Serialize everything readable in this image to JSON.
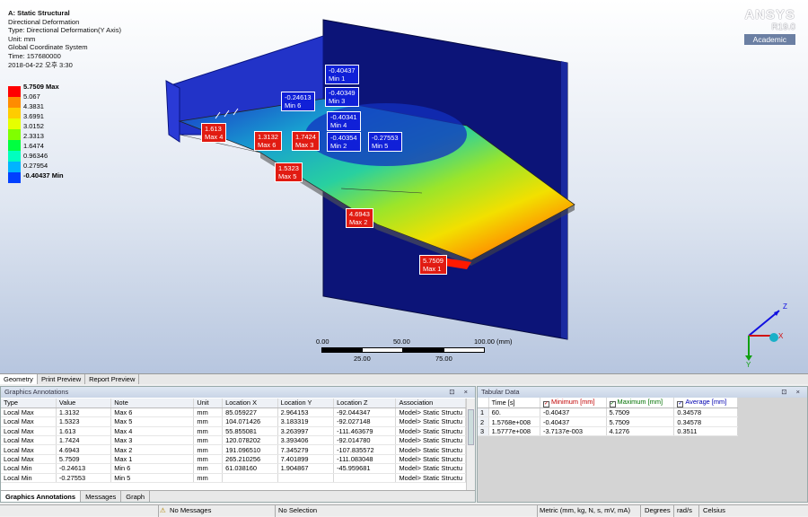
{
  "viewport": {
    "info": {
      "title": "A: Static Structural",
      "lines": [
        "Directional Deformation",
        "Type: Directional Deformation(Y Axis)",
        "Unit: mm",
        "Global Coordinate System",
        "Time: 157680000",
        "2018-04-22 오후 3:30"
      ]
    },
    "legend": {
      "levels": [
        "5.7509 Max",
        "5.067",
        "4.3831",
        "3.6991",
        "3.0152",
        "2.3313",
        "1.6474",
        "0.96346",
        "0.27954",
        "-0.40437 Min"
      ],
      "colors": [
        "#ff0000",
        "#ff8c00",
        "#ffcc00",
        "#e6ff00",
        "#80ff00",
        "#00ff40",
        "#00ffbf",
        "#00b4ff",
        "#0040ff"
      ]
    },
    "brand": {
      "name": "ANSYS",
      "version": "R19.0",
      "edition": "Academic"
    },
    "probes": [
      {
        "value": "-0.40437",
        "label": "Min 1",
        "kind": "min"
      },
      {
        "value": "-0.40349",
        "label": "Min 3",
        "kind": "min"
      },
      {
        "value": "-0.24613",
        "label": "Min 6",
        "kind": "min"
      },
      {
        "value": "-0.40341",
        "label": "Min 4",
        "kind": "min"
      },
      {
        "value": "-0.40354",
        "label": "Min 2",
        "kind": "min"
      },
      {
        "value": "-0.27553",
        "label": "Min 5",
        "kind": "min"
      },
      {
        "value": "1.613",
        "label": "Max 4",
        "kind": "max"
      },
      {
        "value": "1.3132",
        "label": "Max 6",
        "kind": "max"
      },
      {
        "value": "1.7424",
        "label": "Max 3",
        "kind": "max"
      },
      {
        "value": "1.5323",
        "label": "Max 5",
        "kind": "max"
      },
      {
        "value": "4.6943",
        "label": "Max 2",
        "kind": "max"
      },
      {
        "value": "5.7509",
        "label": "Max 1",
        "kind": "max"
      }
    ],
    "scale": {
      "t0": "0.00",
      "t50": "50.00",
      "t100": "100.00 (mm)",
      "t25": "25.00",
      "t75": "75.00"
    },
    "triad": {
      "x": "X",
      "y": "Y",
      "z": "Z"
    }
  },
  "view_tabs": [
    "Geometry",
    "Print Preview",
    "Report Preview"
  ],
  "annotations": {
    "title": "Graphics Annotations",
    "controls": "⊡ ×",
    "columns": [
      "Type",
      "Value",
      "Note",
      "Unit",
      "Location X",
      "Location Y",
      "Location Z",
      "Association"
    ],
    "rows": [
      [
        "Local Max",
        "1.3132",
        "Max 6",
        "mm",
        "85.059227",
        "2.964153",
        "-92.044347",
        "Model> Static Structu"
      ],
      [
        "Local Max",
        "1.5323",
        "Max 5",
        "mm",
        "104.071426",
        "3.183319",
        "-92.027148",
        "Model> Static Structu"
      ],
      [
        "Local Max",
        "1.613",
        "Max 4",
        "mm",
        "55.855081",
        "3.263997",
        "-111.463679",
        "Model> Static Structu"
      ],
      [
        "Local Max",
        "1.7424",
        "Max 3",
        "mm",
        "120.078202",
        "3.393406",
        "-92.014780",
        "Model> Static Structu"
      ],
      [
        "Local Max",
        "4.6943",
        "Max 2",
        "mm",
        "191.096510",
        "7.345279",
        "-107.835572",
        "Model> Static Structu"
      ],
      [
        "Local Max",
        "5.7509",
        "Max 1",
        "mm",
        "265.210256",
        "7.401899",
        "-111.083048",
        "Model> Static Structu"
      ],
      [
        "Local Min",
        "-0.24613",
        "Min 6",
        "mm",
        "61.038160",
        "1.904867",
        "-45.959681",
        "Model> Static Structu"
      ],
      [
        "Local Min",
        "-0.27553",
        "Min 5",
        "mm",
        "",
        "",
        "",
        "Model> Static Structu"
      ]
    ],
    "bottom_tabs": [
      "Graphics Annotations",
      "Messages",
      "Graph"
    ]
  },
  "tabular": {
    "title": "Tabular Data",
    "controls": "⊡ ×",
    "columns": [
      "",
      "Time [s]",
      "Minimum [mm]",
      "Maximum [mm]",
      "Average [mm]"
    ],
    "rows": [
      [
        "1",
        "60.",
        "-0.40437",
        "5.7509",
        "0.34578"
      ],
      [
        "2",
        "1.5768e+008",
        "-0.40437",
        "5.7509",
        "0.34578"
      ],
      [
        "3",
        "1.5777e+008",
        "-3.7137e-003",
        "4.1276",
        "0.3511"
      ]
    ],
    "check_mark": "✓"
  },
  "status": {
    "messages": "No Messages",
    "selection": "No Selection",
    "units": "Metric (mm, kg, N, s, mV, mA)",
    "angle": "Degrees",
    "rate": "rad/s",
    "temp": "Celsius"
  }
}
